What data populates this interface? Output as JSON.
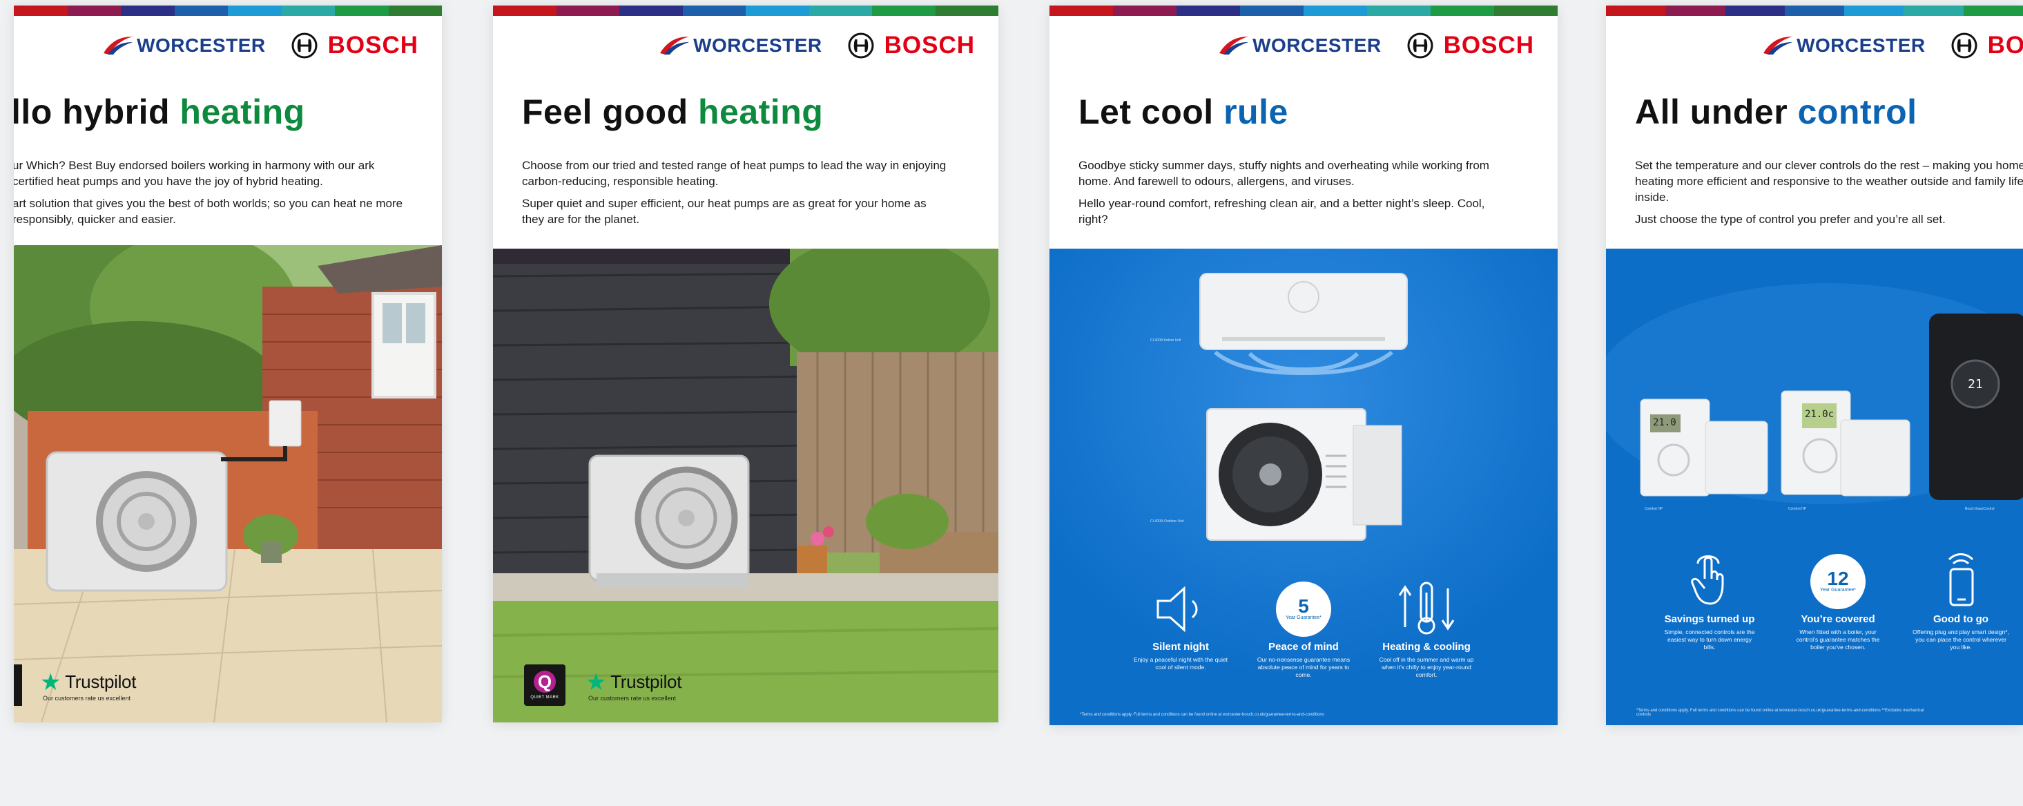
{
  "brand": {
    "worcester": "WORCESTER",
    "bosch": "BOSCH"
  },
  "cards": [
    {
      "heading_pre": "llo hybrid ",
      "heading_accent": "heating",
      "paragraphs": [
        "ur Which? Best Buy endorsed boilers working in harmony with our ark certified heat pumps and you have the joy of hybrid heating.",
        "art solution that gives you the best of both worlds; so you can heat ne more responsibly, quicker and easier."
      ],
      "trustpilot": "Trustpilot",
      "trustpilot_sub": "Our customers rate us excellent"
    },
    {
      "heading_pre": "Feel good ",
      "heading_accent": "heating",
      "paragraphs": [
        "Choose from our tried and tested range of heat pumps to lead the way in enjoying carbon-reducing, responsible heating.",
        "Super quiet and super efficient, our heat pumps are as great for your home as they are for the planet."
      ],
      "quiet_mark": "QUIET MARK",
      "trustpilot": "Trustpilot",
      "trustpilot_sub": "Our customers rate us excellent"
    },
    {
      "heading_pre": "Let cool ",
      "heading_accent": "rule",
      "paragraphs": [
        "Goodbye sticky summer days, stuffy nights and overheating while working from home. And farewell to odours, allergens, and viruses.",
        "Hello year-round comfort, refreshing clean air, and a better night’s sleep. Cool, right?"
      ],
      "unit_label_indoor": "CL4000i Indoor Unit",
      "unit_label_outdoor": "CL4000i Outdoor Unit",
      "features": [
        {
          "title": "Silent night",
          "desc": "Enjoy a peaceful night with the quiet cool of silent mode."
        },
        {
          "title": "Peace of mind",
          "desc": "Our no-nonsense guarantee means absolute peace of mind for years to come.",
          "badge_num": "5",
          "badge_text": "Year Guarantee*"
        },
        {
          "title": "Heating & cooling",
          "desc": "Cool off in the summer and warm up when it’s chilly to enjoy year-round comfort."
        }
      ],
      "footnote": "*Terms and conditions apply. Full terms and conditions can be found online at worcester-bosch.co.uk/guarantee-terms-and-conditions"
    },
    {
      "heading_pre": "All under ",
      "heading_accent": "control",
      "paragraphs": [
        "Set the temperature and our clever controls do the rest – making you home heating more efficient and responsive to the weather outside and family life inside.",
        "Just choose the type of control you prefer and you’re all set."
      ],
      "device_labels": [
        "Comfort HP",
        "Comfort HP",
        "Bosch EasyControl"
      ],
      "device_displays": [
        "21.0",
        "21.0c",
        "21"
      ],
      "features": [
        {
          "title": "Savings turned up",
          "desc": "Simple, connected controls are the easiest way to turn down energy bills."
        },
        {
          "title": "You’re covered",
          "desc": "When fitted with a boiler, your control’s guarantee matches the boiler you’ve chosen.",
          "badge_num": "12",
          "badge_text": "Year Guarantee*"
        },
        {
          "title": "Good to go",
          "desc": "Offering plug and play smart design*, you can place the control wherever you like."
        }
      ],
      "footnote": "*Terms and conditions apply. Full terms and conditions can be found online at worcester-bosch.co.uk/guarantee-terms-and-conditions **Excludes mechanical controls"
    }
  ],
  "colors": {
    "green_accent": "#0e8a3e",
    "blue_accent": "#0b64b2",
    "panel_blue": "#0d6ec8",
    "bosch_red": "#e20015",
    "worcester_navy": "#1a3e8c",
    "trustpilot_green": "#00b67a"
  }
}
